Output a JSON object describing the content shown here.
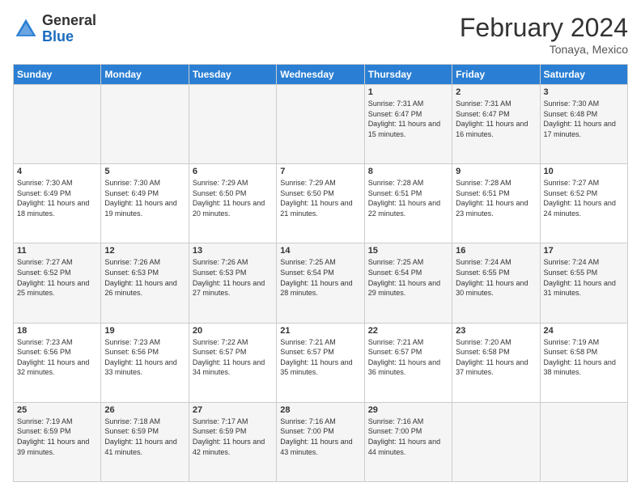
{
  "logo": {
    "general": "General",
    "blue": "Blue"
  },
  "header": {
    "title": "February 2024",
    "subtitle": "Tonaya, Mexico"
  },
  "weekdays": [
    "Sunday",
    "Monday",
    "Tuesday",
    "Wednesday",
    "Thursday",
    "Friday",
    "Saturday"
  ],
  "weeks": [
    [
      {
        "day": "",
        "info": ""
      },
      {
        "day": "",
        "info": ""
      },
      {
        "day": "",
        "info": ""
      },
      {
        "day": "",
        "info": ""
      },
      {
        "day": "1",
        "info": "Sunrise: 7:31 AM\nSunset: 6:47 PM\nDaylight: 11 hours and 15 minutes."
      },
      {
        "day": "2",
        "info": "Sunrise: 7:31 AM\nSunset: 6:47 PM\nDaylight: 11 hours and 16 minutes."
      },
      {
        "day": "3",
        "info": "Sunrise: 7:30 AM\nSunset: 6:48 PM\nDaylight: 11 hours and 17 minutes."
      }
    ],
    [
      {
        "day": "4",
        "info": "Sunrise: 7:30 AM\nSunset: 6:49 PM\nDaylight: 11 hours and 18 minutes."
      },
      {
        "day": "5",
        "info": "Sunrise: 7:30 AM\nSunset: 6:49 PM\nDaylight: 11 hours and 19 minutes."
      },
      {
        "day": "6",
        "info": "Sunrise: 7:29 AM\nSunset: 6:50 PM\nDaylight: 11 hours and 20 minutes."
      },
      {
        "day": "7",
        "info": "Sunrise: 7:29 AM\nSunset: 6:50 PM\nDaylight: 11 hours and 21 minutes."
      },
      {
        "day": "8",
        "info": "Sunrise: 7:28 AM\nSunset: 6:51 PM\nDaylight: 11 hours and 22 minutes."
      },
      {
        "day": "9",
        "info": "Sunrise: 7:28 AM\nSunset: 6:51 PM\nDaylight: 11 hours and 23 minutes."
      },
      {
        "day": "10",
        "info": "Sunrise: 7:27 AM\nSunset: 6:52 PM\nDaylight: 11 hours and 24 minutes."
      }
    ],
    [
      {
        "day": "11",
        "info": "Sunrise: 7:27 AM\nSunset: 6:52 PM\nDaylight: 11 hours and 25 minutes."
      },
      {
        "day": "12",
        "info": "Sunrise: 7:26 AM\nSunset: 6:53 PM\nDaylight: 11 hours and 26 minutes."
      },
      {
        "day": "13",
        "info": "Sunrise: 7:26 AM\nSunset: 6:53 PM\nDaylight: 11 hours and 27 minutes."
      },
      {
        "day": "14",
        "info": "Sunrise: 7:25 AM\nSunset: 6:54 PM\nDaylight: 11 hours and 28 minutes."
      },
      {
        "day": "15",
        "info": "Sunrise: 7:25 AM\nSunset: 6:54 PM\nDaylight: 11 hours and 29 minutes."
      },
      {
        "day": "16",
        "info": "Sunrise: 7:24 AM\nSunset: 6:55 PM\nDaylight: 11 hours and 30 minutes."
      },
      {
        "day": "17",
        "info": "Sunrise: 7:24 AM\nSunset: 6:55 PM\nDaylight: 11 hours and 31 minutes."
      }
    ],
    [
      {
        "day": "18",
        "info": "Sunrise: 7:23 AM\nSunset: 6:56 PM\nDaylight: 11 hours and 32 minutes."
      },
      {
        "day": "19",
        "info": "Sunrise: 7:23 AM\nSunset: 6:56 PM\nDaylight: 11 hours and 33 minutes."
      },
      {
        "day": "20",
        "info": "Sunrise: 7:22 AM\nSunset: 6:57 PM\nDaylight: 11 hours and 34 minutes."
      },
      {
        "day": "21",
        "info": "Sunrise: 7:21 AM\nSunset: 6:57 PM\nDaylight: 11 hours and 35 minutes."
      },
      {
        "day": "22",
        "info": "Sunrise: 7:21 AM\nSunset: 6:57 PM\nDaylight: 11 hours and 36 minutes."
      },
      {
        "day": "23",
        "info": "Sunrise: 7:20 AM\nSunset: 6:58 PM\nDaylight: 11 hours and 37 minutes."
      },
      {
        "day": "24",
        "info": "Sunrise: 7:19 AM\nSunset: 6:58 PM\nDaylight: 11 hours and 38 minutes."
      }
    ],
    [
      {
        "day": "25",
        "info": "Sunrise: 7:19 AM\nSunset: 6:59 PM\nDaylight: 11 hours and 39 minutes."
      },
      {
        "day": "26",
        "info": "Sunrise: 7:18 AM\nSunset: 6:59 PM\nDaylight: 11 hours and 41 minutes."
      },
      {
        "day": "27",
        "info": "Sunrise: 7:17 AM\nSunset: 6:59 PM\nDaylight: 11 hours and 42 minutes."
      },
      {
        "day": "28",
        "info": "Sunrise: 7:16 AM\nSunset: 7:00 PM\nDaylight: 11 hours and 43 minutes."
      },
      {
        "day": "29",
        "info": "Sunrise: 7:16 AM\nSunset: 7:00 PM\nDaylight: 11 hours and 44 minutes."
      },
      {
        "day": "",
        "info": ""
      },
      {
        "day": "",
        "info": ""
      }
    ]
  ]
}
